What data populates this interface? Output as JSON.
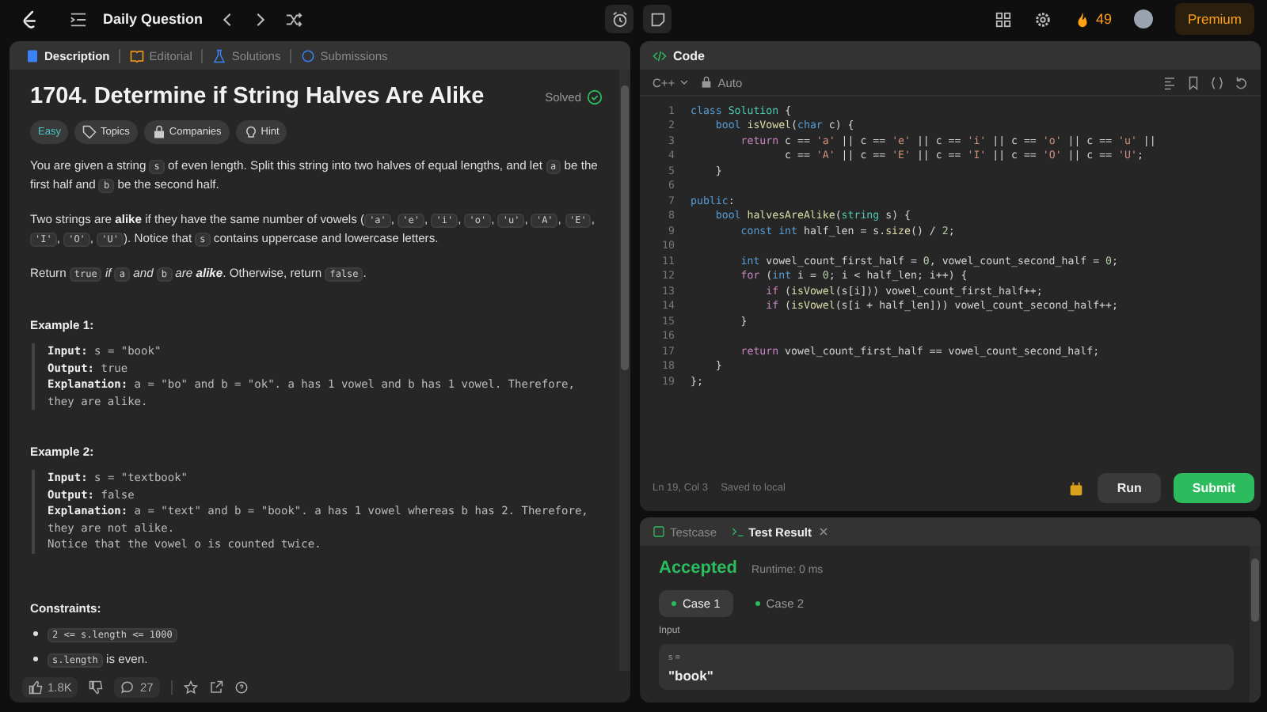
{
  "topbar": {
    "title": "Daily Question",
    "streak": "49",
    "premium": "Premium"
  },
  "left_tabs": [
    {
      "label": "Description",
      "kind": "doc",
      "selected": true
    },
    {
      "label": "Editorial",
      "kind": "book",
      "selected": false
    },
    {
      "label": "Solutions",
      "kind": "flask",
      "selected": false
    },
    {
      "label": "Submissions",
      "kind": "clock",
      "selected": false
    }
  ],
  "problem": {
    "title": "1704. Determine if String Halves Are Alike",
    "status": "Solved",
    "difficulty": "Easy",
    "tags": [
      {
        "label": "Topics",
        "kind": "tag"
      },
      {
        "label": "Companies",
        "kind": "lock"
      },
      {
        "label": "Hint",
        "kind": "bulb"
      }
    ],
    "paragraphs": [
      [
        {
          "kind": "text",
          "text": "You are given a string "
        },
        {
          "kind": "code",
          "text": "s"
        },
        {
          "kind": "text",
          "text": " of even length. Split this string into two halves of equal lengths, and let "
        },
        {
          "kind": "code",
          "text": "a"
        },
        {
          "kind": "text",
          "text": " be the first half and "
        },
        {
          "kind": "code",
          "text": "b"
        },
        {
          "kind": "text",
          "text": " be the second half."
        }
      ],
      [
        {
          "kind": "text",
          "text": "Two strings are "
        },
        {
          "kind": "bold",
          "text": "alike"
        },
        {
          "kind": "text",
          "text": " if they have the same number of vowels ("
        },
        {
          "kind": "code",
          "text": "'a'"
        },
        {
          "kind": "text",
          "text": ", "
        },
        {
          "kind": "code",
          "text": "'e'"
        },
        {
          "kind": "text",
          "text": ", "
        },
        {
          "kind": "code",
          "text": "'i'"
        },
        {
          "kind": "text",
          "text": ", "
        },
        {
          "kind": "code",
          "text": "'o'"
        },
        {
          "kind": "text",
          "text": ", "
        },
        {
          "kind": "code",
          "text": "'u'"
        },
        {
          "kind": "text",
          "text": ", "
        },
        {
          "kind": "code",
          "text": "'A'"
        },
        {
          "kind": "text",
          "text": ", "
        },
        {
          "kind": "code",
          "text": "'E'"
        },
        {
          "kind": "text",
          "text": ", "
        },
        {
          "kind": "code",
          "text": "'I'"
        },
        {
          "kind": "text",
          "text": ", "
        },
        {
          "kind": "code",
          "text": "'O'"
        },
        {
          "kind": "text",
          "text": ", "
        },
        {
          "kind": "code",
          "text": "'U'"
        },
        {
          "kind": "text",
          "text": "). Notice that "
        },
        {
          "kind": "code",
          "text": "s"
        },
        {
          "kind": "text",
          "text": " contains uppercase and lowercase letters."
        }
      ],
      [
        {
          "kind": "text",
          "text": "Return "
        },
        {
          "kind": "code",
          "text": "true"
        },
        {
          "kind": "italic",
          "text": " if "
        },
        {
          "kind": "code",
          "text": "a"
        },
        {
          "kind": "italic",
          "text": " and "
        },
        {
          "kind": "code",
          "text": "b"
        },
        {
          "kind": "italic",
          "text": " are "
        },
        {
          "kind": "bolditalic",
          "text": "alike"
        },
        {
          "kind": "text",
          "text": ". Otherwise, return "
        },
        {
          "kind": "code",
          "text": "false"
        },
        {
          "kind": "text",
          "text": "."
        }
      ]
    ],
    "examples": [
      {
        "title": "Example 1:",
        "lines": [
          {
            "label": "Input:",
            "value": " s = \"book\""
          },
          {
            "label": "Output:",
            "value": " true"
          },
          {
            "label": "Explanation:",
            "value": " a = \"bo\" and b = \"ok\". a has 1 vowel and b has 1 vowel. Therefore, they are alike."
          }
        ]
      },
      {
        "title": "Example 2:",
        "lines": [
          {
            "label": "Input:",
            "value": " s = \"textbook\""
          },
          {
            "label": "Output:",
            "value": " false"
          },
          {
            "label": "Explanation:",
            "value": " a = \"text\" and b = \"book\". a has 1 vowel whereas b has 2. Therefore, they are not alike."
          },
          {
            "value": "Notice that the vowel o is counted twice."
          }
        ]
      }
    ],
    "constraints_title": "Constraints:",
    "constraints": [
      [
        {
          "kind": "code",
          "text": "2 <= s.length <= 1000"
        }
      ],
      [
        {
          "kind": "code",
          "text": "s.length"
        },
        {
          "kind": "text",
          "text": " is even."
        }
      ]
    ],
    "likes": "1.8K",
    "comments": "27"
  },
  "editor": {
    "title": "Code",
    "language": "C++",
    "mode": "Auto",
    "lines": [
      {
        "no": "1",
        "tokens": [
          {
            "kind": "keyword",
            "text": "class "
          },
          {
            "kind": "type",
            "text": "Solution"
          },
          {
            "kind": "plain",
            "text": " {"
          }
        ]
      },
      {
        "no": "2",
        "tokens": [
          {
            "kind": "keyword",
            "text": "    bool "
          },
          {
            "kind": "func",
            "text": "isVowel"
          },
          {
            "kind": "plain",
            "text": "("
          },
          {
            "kind": "keyword",
            "text": "char "
          },
          {
            "kind": "plain",
            "text": "c) {"
          }
        ]
      },
      {
        "no": "3",
        "tokens": [
          {
            "kind": "control",
            "text": "        return "
          },
          {
            "kind": "plain",
            "text": "c == "
          },
          {
            "kind": "string",
            "text": "'a'"
          },
          {
            "kind": "plain",
            "text": " || c == "
          },
          {
            "kind": "string",
            "text": "'e'"
          },
          {
            "kind": "plain",
            "text": " || c == "
          },
          {
            "kind": "string",
            "text": "'i'"
          },
          {
            "kind": "plain",
            "text": " || c == "
          },
          {
            "kind": "string",
            "text": "'o'"
          },
          {
            "kind": "plain",
            "text": " || c == "
          },
          {
            "kind": "string",
            "text": "'u'"
          },
          {
            "kind": "plain",
            "text": " ||"
          }
        ]
      },
      {
        "no": "4",
        "tokens": [
          {
            "kind": "plain",
            "text": "               c == "
          },
          {
            "kind": "string",
            "text": "'A'"
          },
          {
            "kind": "plain",
            "text": " || c == "
          },
          {
            "kind": "string",
            "text": "'E'"
          },
          {
            "kind": "plain",
            "text": " || c == "
          },
          {
            "kind": "string",
            "text": "'I'"
          },
          {
            "kind": "plain",
            "text": " || c == "
          },
          {
            "kind": "string",
            "text": "'O'"
          },
          {
            "kind": "plain",
            "text": " || c == "
          },
          {
            "kind": "string",
            "text": "'U'"
          },
          {
            "kind": "plain",
            "text": ";"
          }
        ]
      },
      {
        "no": "5",
        "tokens": [
          {
            "kind": "plain",
            "text": "    }"
          }
        ]
      },
      {
        "no": "6"
      },
      {
        "no": "7",
        "tokens": [
          {
            "kind": "keyword",
            "text": "public"
          },
          {
            "kind": "plain",
            "text": ":"
          }
        ]
      },
      {
        "no": "8",
        "tokens": [
          {
            "kind": "keyword",
            "text": "    bool "
          },
          {
            "kind": "func",
            "text": "halvesAreAlike"
          },
          {
            "kind": "plain",
            "text": "("
          },
          {
            "kind": "type",
            "text": "string "
          },
          {
            "kind": "plain",
            "text": "s) {"
          }
        ]
      },
      {
        "no": "9",
        "tokens": [
          {
            "kind": "keyword",
            "text": "        const int "
          },
          {
            "kind": "plain",
            "text": "half_len = s."
          },
          {
            "kind": "func",
            "text": "size"
          },
          {
            "kind": "plain",
            "text": "() / "
          },
          {
            "kind": "number",
            "text": "2"
          },
          {
            "kind": "plain",
            "text": ";"
          }
        ]
      },
      {
        "no": "10"
      },
      {
        "no": "11",
        "tokens": [
          {
            "kind": "keyword",
            "text": "        int "
          },
          {
            "kind": "plain",
            "text": "vowel_count_first_half = "
          },
          {
            "kind": "number",
            "text": "0"
          },
          {
            "kind": "plain",
            "text": ", vowel_count_second_half = "
          },
          {
            "kind": "number",
            "text": "0"
          },
          {
            "kind": "plain",
            "text": ";"
          }
        ]
      },
      {
        "no": "12",
        "tokens": [
          {
            "kind": "control",
            "text": "        for "
          },
          {
            "kind": "plain",
            "text": "("
          },
          {
            "kind": "keyword",
            "text": "int "
          },
          {
            "kind": "plain",
            "text": "i = "
          },
          {
            "kind": "number",
            "text": "0"
          },
          {
            "kind": "plain",
            "text": "; i < half_len; i++) {"
          }
        ]
      },
      {
        "no": "13",
        "tokens": [
          {
            "kind": "control",
            "text": "            if "
          },
          {
            "kind": "plain",
            "text": "("
          },
          {
            "kind": "func",
            "text": "isVowel"
          },
          {
            "kind": "plain",
            "text": "(s[i])) vowel_count_first_half++;"
          }
        ]
      },
      {
        "no": "14",
        "tokens": [
          {
            "kind": "control",
            "text": "            if "
          },
          {
            "kind": "plain",
            "text": "("
          },
          {
            "kind": "func",
            "text": "isVowel"
          },
          {
            "kind": "plain",
            "text": "(s[i + half_len])) vowel_count_second_half++;"
          }
        ]
      },
      {
        "no": "15",
        "tokens": [
          {
            "kind": "plain",
            "text": "        }"
          }
        ]
      },
      {
        "no": "16"
      },
      {
        "no": "17",
        "tokens": [
          {
            "kind": "control",
            "text": "        return "
          },
          {
            "kind": "plain",
            "text": "vowel_count_first_half == vowel_count_second_half;"
          }
        ]
      },
      {
        "no": "18",
        "tokens": [
          {
            "kind": "plain",
            "text": "    }"
          }
        ]
      },
      {
        "no": "19",
        "tokens": [
          {
            "kind": "plain",
            "text": "};"
          }
        ]
      }
    ],
    "position": "Ln 19, Col 3",
    "saved": "Saved to local",
    "run": "Run",
    "submit": "Submit"
  },
  "console": {
    "tabs": [
      {
        "label": "Testcase",
        "kind": "check",
        "selected": false
      },
      {
        "label": "Test Result",
        "kind": "terminal",
        "selected": true
      }
    ],
    "verdict": "Accepted",
    "runtime": "Runtime: 0 ms",
    "cases": [
      {
        "label": "Case 1",
        "selected": true,
        "color": "#2cbb5d"
      },
      {
        "label": "Case 2",
        "selected": false,
        "color": "#2cbb5d"
      }
    ],
    "input_label": "Input",
    "var": "s =",
    "value": "\"book\""
  }
}
